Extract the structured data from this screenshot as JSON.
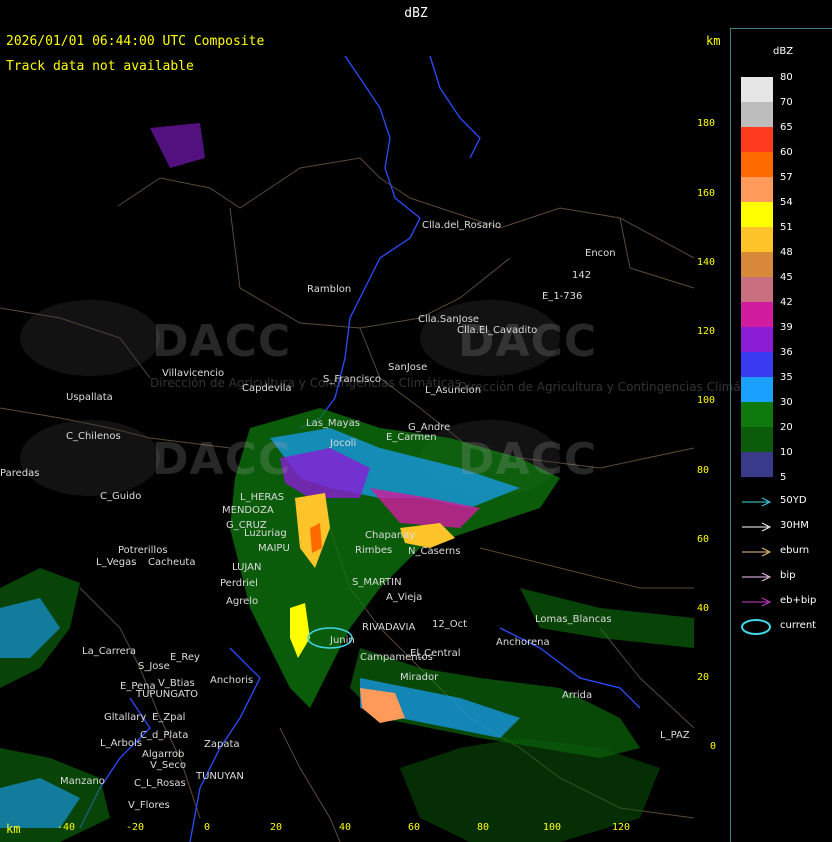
{
  "window": {
    "title": "dBZ"
  },
  "header": {
    "timestamp_line": "2026/01/01 06:44:00 UTC Composite",
    "track_note": "Track data not available",
    "km_top": "km",
    "km_bottom": "km"
  },
  "axes": {
    "y_ticks": [
      "180",
      "160",
      "140",
      "120",
      "100",
      "80",
      "60",
      "40",
      "20",
      "0"
    ],
    "x_ticks": [
      "-40",
      "-20",
      "0",
      "20",
      "40",
      "60",
      "80",
      "100",
      "120"
    ]
  },
  "legend": {
    "title": "dBZ",
    "scale": [
      {
        "label": "80",
        "color": "#e6e6e6"
      },
      {
        "label": "70",
        "color": "#bdbdbd"
      },
      {
        "label": "65",
        "color": "#ff3b1f"
      },
      {
        "label": "60",
        "color": "#ff6a00"
      },
      {
        "label": "57",
        "color": "#ff9a5a"
      },
      {
        "label": "54",
        "color": "#ffff00"
      },
      {
        "label": "51",
        "color": "#ffc42a"
      },
      {
        "label": "48",
        "color": "#d88a3a"
      },
      {
        "label": "45",
        "color": "#c86f80"
      },
      {
        "label": "42",
        "color": "#d21ca0"
      },
      {
        "label": "39",
        "color": "#8a1cd6"
      },
      {
        "label": "36",
        "color": "#3a3af2"
      },
      {
        "label": "35",
        "color": "#1aa1ff"
      },
      {
        "label": "30",
        "color": "#0e7a0e"
      },
      {
        "label": "20",
        "color": "#0a5c0a"
      },
      {
        "label": "10",
        "color": "#3a3a8a"
      },
      {
        "label": "5",
        "color": "#3a3a8a"
      }
    ],
    "tracks": [
      {
        "label": "50YD",
        "color": "#43d6e6"
      },
      {
        "label": "30HM",
        "color": "#ffffff"
      },
      {
        "label": "eburn",
        "color": "#f2c27a"
      },
      {
        "label": "bip",
        "color": "#f2c7f2"
      },
      {
        "label": "eb+bip",
        "color": "#d23ad2"
      },
      {
        "label": "current",
        "color": "#43d6e6"
      }
    ]
  },
  "watermark": {
    "brand": "DACC",
    "subtitle_left": "Dirección de Agricultura y Contingencias Climáticas",
    "subtitle_right": "Dirección de Agricultura y Contingencias Climáticas"
  },
  "places": [
    {
      "name": "Clla.del_Rosario"
    },
    {
      "name": "Encon"
    },
    {
      "name": "142"
    },
    {
      "name": "E_1-736"
    },
    {
      "name": "Ramblon"
    },
    {
      "name": "Clla.SanJose"
    },
    {
      "name": "Clla.El_Cavadito"
    },
    {
      "name": "Villavicencio"
    },
    {
      "name": "Capdevila"
    },
    {
      "name": "S_Francisco"
    },
    {
      "name": "SanJose"
    },
    {
      "name": "L_Asuncion"
    },
    {
      "name": "Uspallata"
    },
    {
      "name": "C_Chilenos"
    },
    {
      "name": "Las_Mayas"
    },
    {
      "name": "G_Andre"
    },
    {
      "name": "E_Carmen"
    },
    {
      "name": "Jocoli"
    },
    {
      "name": "L_HERAS"
    },
    {
      "name": "MENDOZA"
    },
    {
      "name": "G_CRUZ"
    },
    {
      "name": "Luzuriag"
    },
    {
      "name": "MAIPU"
    },
    {
      "name": "Chapanay"
    },
    {
      "name": "Rimbes"
    },
    {
      "name": "N_Caserns"
    },
    {
      "name": "Potrerillos"
    },
    {
      "name": "Cacheuta"
    },
    {
      "name": "L_Vegas"
    },
    {
      "name": "C_Guido"
    },
    {
      "name": "Perdriel"
    },
    {
      "name": "LUJAN"
    },
    {
      "name": "S_MARTIN"
    },
    {
      "name": "Agrelo"
    },
    {
      "name": "A_Vieja"
    },
    {
      "name": "Lomas_Blancas"
    },
    {
      "name": "La_Carrera"
    },
    {
      "name": "S_Jose"
    },
    {
      "name": "E_Rey"
    },
    {
      "name": "RIVADAVIA"
    },
    {
      "name": "12_Oct"
    },
    {
      "name": "Junin"
    },
    {
      "name": "TUPUNGATO"
    },
    {
      "name": "E_Pena"
    },
    {
      "name": "V_Btias"
    },
    {
      "name": "Anchoris"
    },
    {
      "name": "Campamentos"
    },
    {
      "name": "El_Central"
    },
    {
      "name": "Mirador"
    },
    {
      "name": "Anchorena"
    },
    {
      "name": "Arrida"
    },
    {
      "name": "Gltallary"
    },
    {
      "name": "E_Zpal"
    },
    {
      "name": "L_Arbols"
    },
    {
      "name": "C_d_Plata"
    },
    {
      "name": "Algarrob"
    },
    {
      "name": "Zapata"
    },
    {
      "name": "V_Seco"
    },
    {
      "name": "TUNUYAN"
    },
    {
      "name": "C_L_Rosas"
    },
    {
      "name": "Manzano"
    },
    {
      "name": "V_Flores"
    },
    {
      "name": "L_PAZ"
    },
    {
      "name": "Paredas"
    }
  ]
}
